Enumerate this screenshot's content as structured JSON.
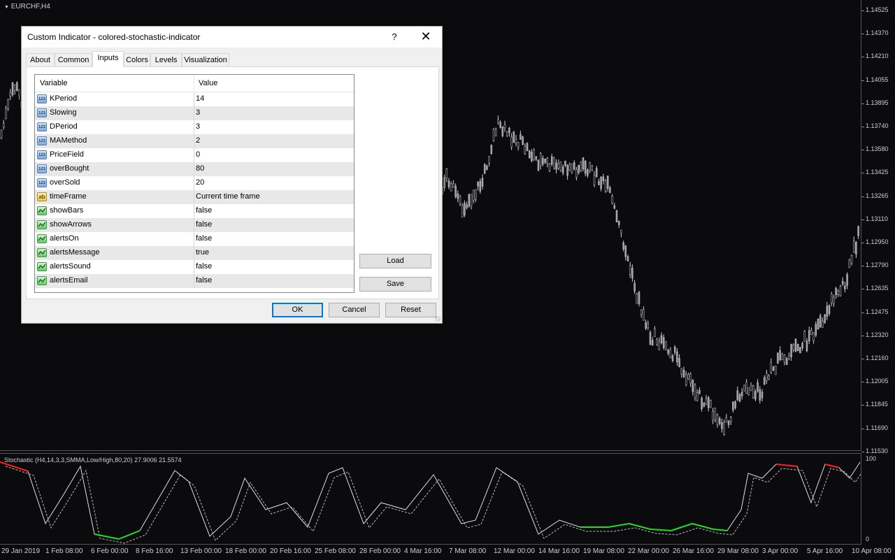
{
  "symbol": "EURCHF,H4",
  "price_axis": [
    "1.14525",
    "1.14370",
    "1.14210",
    "1.14055",
    "1.13895",
    "1.13740",
    "1.13580",
    "1.13425",
    "1.13265",
    "1.13110",
    "1.12950",
    "1.12790",
    "1.12635",
    "1.12475",
    "1.12320",
    "1.12160",
    "1.12005",
    "1.11845",
    "1.11690",
    "1.11530"
  ],
  "stochastic_label": "Stochastic (H4,14,3,3,SMMA,Low/High,80,20) 27.9006 21.5574",
  "stochastic_axis": {
    "top": "100",
    "bottom": "0"
  },
  "date_axis": [
    "29 Jan 2019",
    "1 Feb 08:00",
    "6 Feb 00:00",
    "8 Feb 16:00",
    "13 Feb 00:00",
    "18 Feb 00:00",
    "20 Feb 16:00",
    "25 Feb 08:00",
    "28 Feb 00:00",
    "4 Mar 16:00",
    "7 Mar 08:00",
    "12 Mar 00:00",
    "14 Mar 16:00",
    "19 Mar 08:00",
    "22 Mar 00:00",
    "26 Mar 16:00",
    "29 Mar 08:00",
    "3 Apr 00:00",
    "5 Apr 16:00",
    "10 Apr 08:00"
  ],
  "colors": {
    "overbought": "#ff2020",
    "oversold": "#22dd22",
    "line": "#e0e0e0",
    "candle": "#d0d0d0"
  },
  "dialog": {
    "title": "Custom Indicator - colored-stochastic-indicator",
    "help": "?",
    "close": "✕",
    "tabs": [
      "About",
      "Common",
      "Inputs",
      "Colors",
      "Levels",
      "Visualization"
    ],
    "active_tab": "Inputs",
    "columns": {
      "variable": "Variable",
      "value": "Value"
    },
    "rows": [
      {
        "type": "123",
        "name": "KPeriod",
        "value": "14"
      },
      {
        "type": "123",
        "name": "Slowing",
        "value": "3"
      },
      {
        "type": "123",
        "name": "DPeriod",
        "value": "3"
      },
      {
        "type": "123",
        "name": "MAMethod",
        "value": "2"
      },
      {
        "type": "123",
        "name": "PriceField",
        "value": "0"
      },
      {
        "type": "123",
        "name": "overBought",
        "value": "80"
      },
      {
        "type": "123",
        "name": "overSold",
        "value": "20"
      },
      {
        "type": "ab",
        "name": "timeFrame",
        "value": "Current time frame"
      },
      {
        "type": "bool",
        "name": "showBars",
        "value": "false"
      },
      {
        "type": "bool",
        "name": "showArrows",
        "value": "false"
      },
      {
        "type": "bool",
        "name": "alertsOn",
        "value": "false"
      },
      {
        "type": "bool",
        "name": "alertsMessage",
        "value": "true"
      },
      {
        "type": "bool",
        "name": "alertsSound",
        "value": "false"
      },
      {
        "type": "bool",
        "name": "alertsEmail",
        "value": "false"
      }
    ],
    "buttons": {
      "load": "Load",
      "save": "Save",
      "ok": "OK",
      "cancel": "Cancel",
      "reset": "Reset"
    }
  }
}
